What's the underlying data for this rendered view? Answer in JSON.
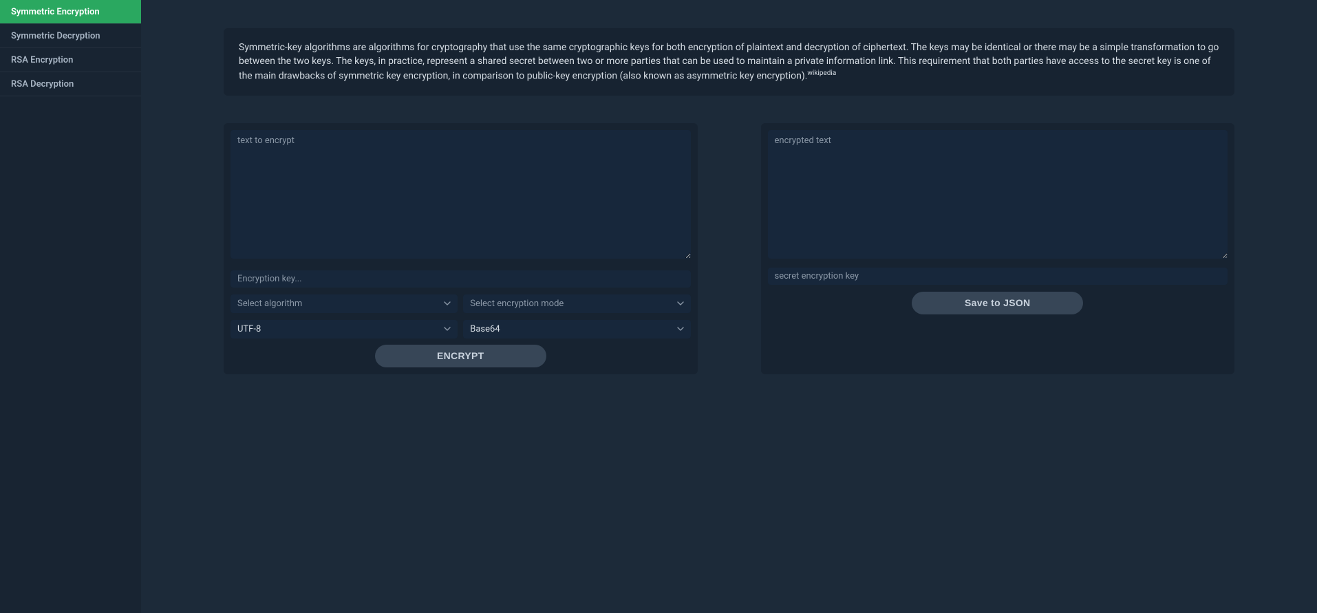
{
  "sidebar": {
    "items": [
      {
        "label": "Symmetric Encryption",
        "active": true
      },
      {
        "label": "Symmetric Decryption",
        "active": false
      },
      {
        "label": "RSA Encryption",
        "active": false
      },
      {
        "label": "RSA Decryption",
        "active": false
      }
    ]
  },
  "info": {
    "text": "Symmetric-key algorithms are algorithms for cryptography that use the same cryptographic keys for both encryption of plaintext and decryption of ciphertext. The keys may be identical or there may be a simple transformation to go between the two keys. The keys, in practice, represent a shared secret between two or more parties that can be used to maintain a private information link. This requirement that both parties have access to the secret key is one of the main drawbacks of symmetric key encryption, in comparison to public-key encryption (also known as asymmetric key encryption).",
    "source": "wikipedia"
  },
  "left_panel": {
    "text_placeholder": "text to encrypt",
    "text_value": "",
    "key_placeholder": "Encryption key...",
    "key_value": "",
    "algorithm_placeholder": "Select algorithm",
    "mode_placeholder": "Select encryption mode",
    "encoding_value": "UTF-8",
    "output_format_value": "Base64",
    "encrypt_button": "ENCRYPT"
  },
  "right_panel": {
    "text_placeholder": "encrypted text",
    "text_value": "",
    "key_placeholder": "secret encryption key",
    "key_value": "",
    "save_button": "Save to JSON"
  }
}
